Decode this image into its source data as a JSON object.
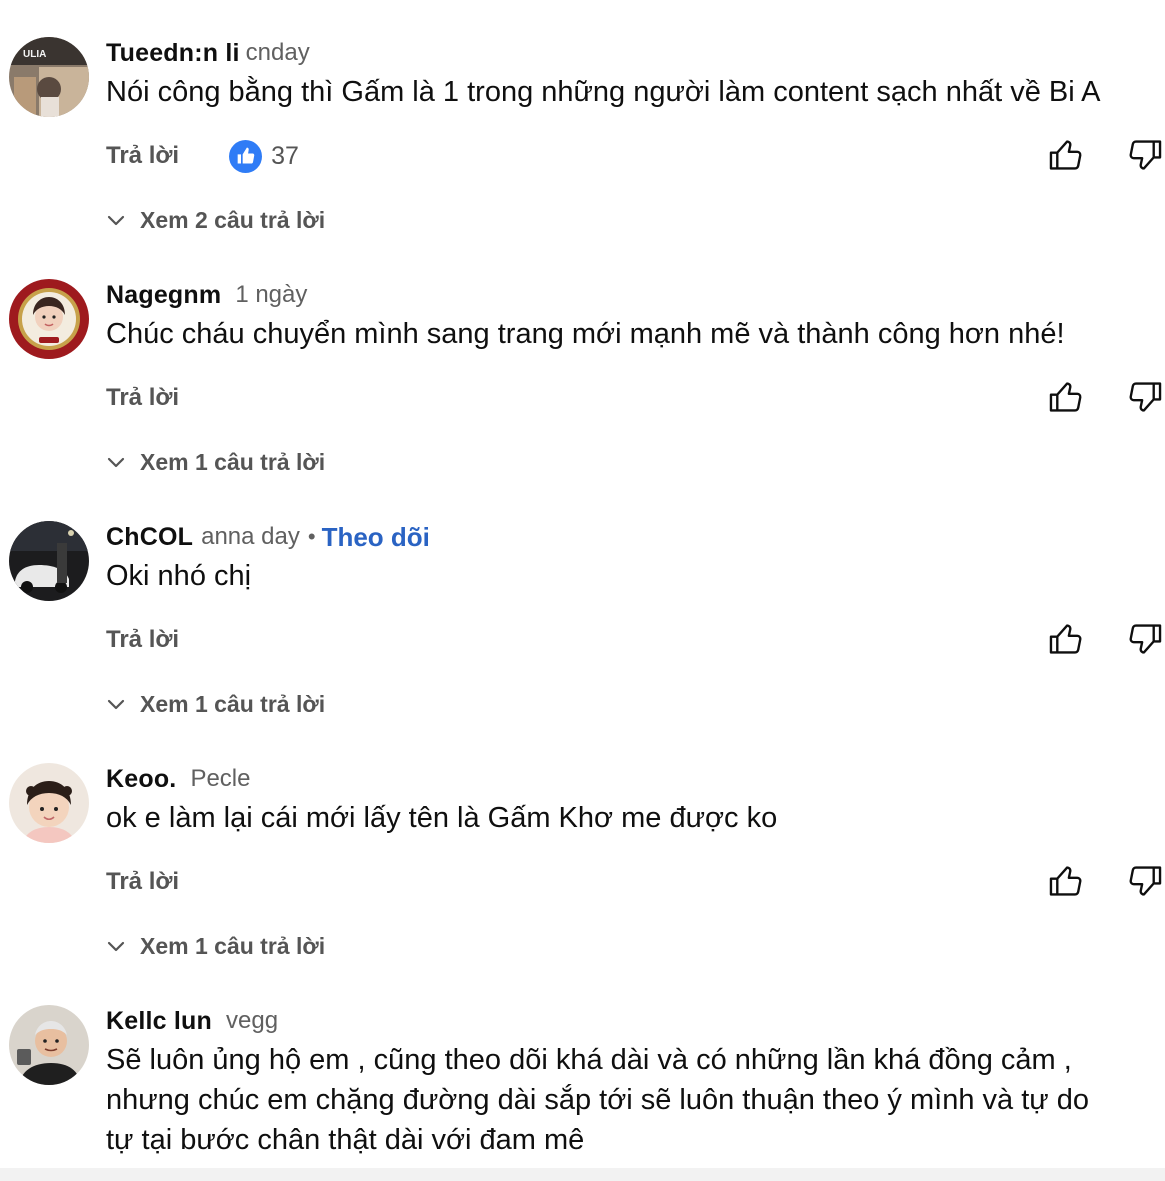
{
  "labels": {
    "reply": "Trả lời",
    "follow": "Theo dõi"
  },
  "comments": [
    {
      "author": "Tueedn:n li",
      "time": "cnday",
      "text": "Nói công bằng thì Gấm là 1 trong những người làm content sạch nhất về Bi A",
      "likes": "37",
      "replies_label": "Xem 2 câu trả lời",
      "avatar_text": "ULIA"
    },
    {
      "author": "Nagegnm",
      "time": "1 ngày",
      "text": "Chúc cháu chuyển mình sang trang mới mạnh mẽ và thành công hơn nhé!",
      "replies_label": "Xem 1 câu trả lời"
    },
    {
      "author": "ChCOL",
      "time": "anna day",
      "text": "Oki nhó chị",
      "replies_label": "Xem 1 câu trả lời"
    },
    {
      "author": "Keoo.",
      "time": "Pecle",
      "text": "ok e làm lại cái mới lấy tên là Gấm Khơ me được ko",
      "replies_label": "Xem 1 câu trả lời"
    },
    {
      "author": "Kellc lun",
      "time": "vegg",
      "text_lines": [
        "Sẽ luôn ủng hộ em , cũng theo dõi khá dài và có những lần khá đồng cảm ,",
        "nhưng chúc em chặng đường dài sắp tới sẽ luôn thuận theo ý mình và tự do",
        "tự tại bước chân thật dài với đam mê"
      ]
    }
  ],
  "colors": {
    "link_blue": "#2a63c3",
    "like_blue": "#2f7cf6",
    "secondary_text": "#555555"
  },
  "icons": [
    "thumbs-up-icon",
    "thumbs-down-icon",
    "chevron-down-icon",
    "like-reaction-icon"
  ]
}
